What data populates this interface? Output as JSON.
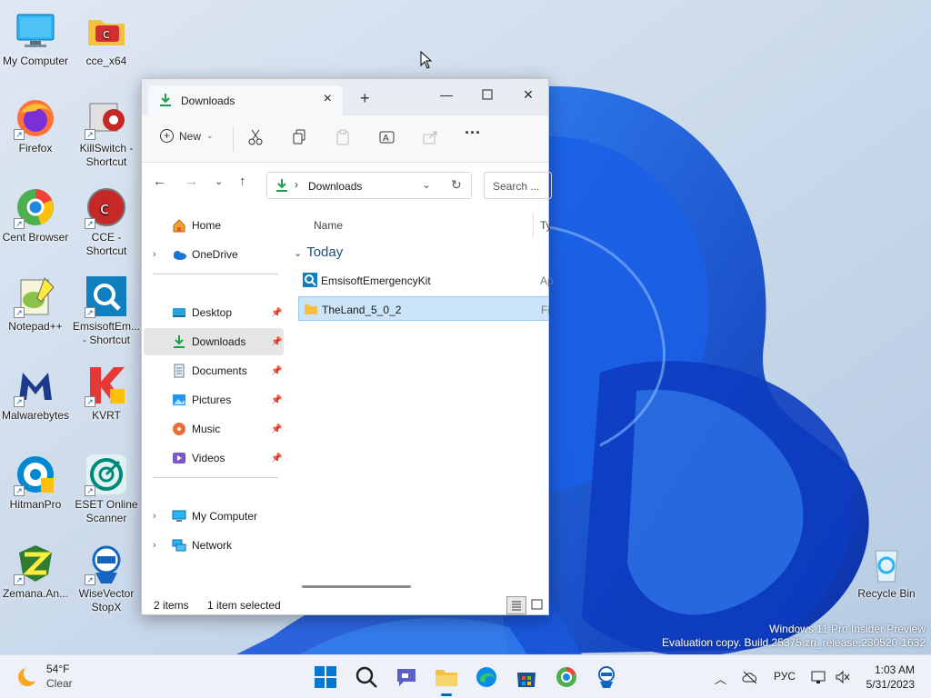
{
  "desktop": {
    "icons": [
      {
        "label": "My Computer",
        "icon": "monitor-icon"
      },
      {
        "label": "cce_x64",
        "icon": "folder-icon"
      },
      {
        "label": "Firefox",
        "icon": "firefox-icon"
      },
      {
        "label": "KillSwitch -\nShortcut",
        "icon": "killswitch-icon"
      },
      {
        "label": "Cent Browser",
        "icon": "cent-browser-icon"
      },
      {
        "label": "CCE -\nShortcut",
        "icon": "cce-icon"
      },
      {
        "label": "Notepad++",
        "icon": "notepadpp-icon"
      },
      {
        "label": "EmsisoftEm...\n- Shortcut",
        "icon": "emsisoft-icon"
      },
      {
        "label": "Malwarebytes",
        "icon": "malwarebytes-icon"
      },
      {
        "label": "KVRT",
        "icon": "kvrt-icon"
      },
      {
        "label": "HitmanPro",
        "icon": "hitmanpro-icon"
      },
      {
        "label": "ESET Online\nScanner",
        "icon": "eset-icon"
      },
      {
        "label": "Zemana.An...",
        "icon": "zemana-icon"
      },
      {
        "label": "WiseVector\nStopX",
        "icon": "wisevector-icon"
      },
      {
        "label": "Recycle Bin",
        "icon": "recycle-bin-icon"
      }
    ],
    "watermark": {
      "line1": "Windows 11 Pro Insider Preview",
      "line2": "Evaluation copy. Build 25375.zn_release.230520-1632"
    }
  },
  "explorer": {
    "tab_title": "Downloads",
    "toolbar": {
      "new_label": "New",
      "more_label": "···"
    },
    "address": {
      "path": "Downloads",
      "search_placeholder": "Search ..."
    },
    "nav": {
      "home": "Home",
      "onedrive": "OneDrive",
      "quick": [
        {
          "label": "Desktop",
          "icon": "desktop-folder-icon"
        },
        {
          "label": "Downloads",
          "icon": "downloads-icon",
          "selected": true
        },
        {
          "label": "Documents",
          "icon": "documents-icon"
        },
        {
          "label": "Pictures",
          "icon": "pictures-icon"
        },
        {
          "label": "Music",
          "icon": "music-icon"
        },
        {
          "label": "Videos",
          "icon": "videos-icon"
        }
      ],
      "my_computer": "My Computer",
      "network": "Network"
    },
    "content": {
      "col_name": "Name",
      "col_type": "Ty",
      "group": "Today",
      "files": [
        {
          "name": "EmsisoftEmergencyKit",
          "type": "Ap",
          "selected": false
        },
        {
          "name": "TheLand_5_0_2",
          "type": "Fi",
          "selected": true
        }
      ]
    },
    "status": {
      "count": "2 items",
      "selected": "1 item selected"
    }
  },
  "taskbar": {
    "weather": {
      "temp": "54°F",
      "condition": "Clear"
    },
    "language": "РУС",
    "time": "1:03 AM",
    "date": "5/31/2023"
  },
  "colors": {
    "accent": "#0067c0",
    "selection": "#cce4f7",
    "wallpaper_blue": "#1446d8"
  }
}
